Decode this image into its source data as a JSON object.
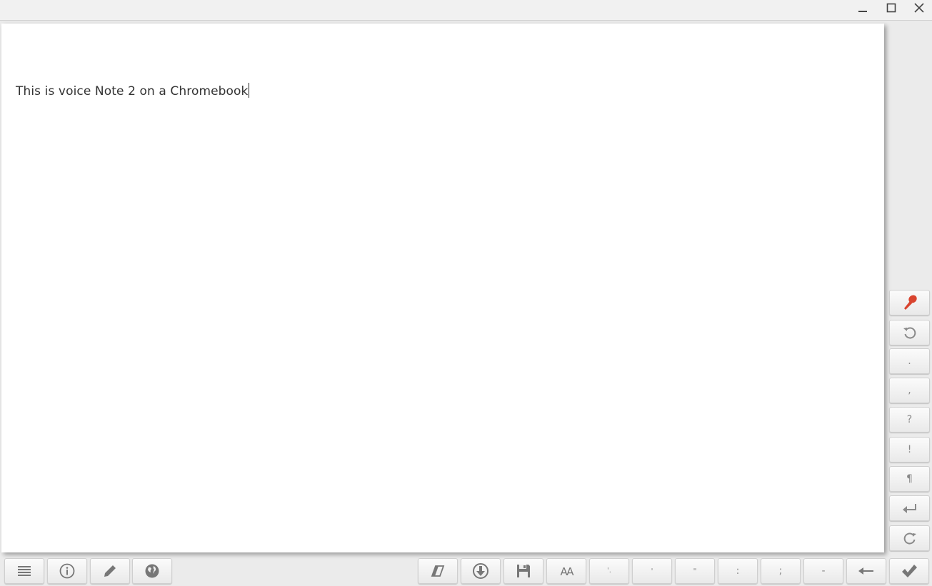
{
  "window": {
    "controls": [
      {
        "name": "minimize-icon"
      },
      {
        "name": "maximize-icon"
      },
      {
        "name": "close-icon"
      }
    ]
  },
  "editor": {
    "text": "This is voice Note 2 on a Chromebook"
  },
  "side_toolbar": {
    "buttons": [
      {
        "name": "microphone-icon",
        "color": "#d9442f"
      },
      {
        "name": "undo-icon"
      },
      {
        "label": "."
      },
      {
        "label": ","
      },
      {
        "label": "?"
      },
      {
        "label": "!"
      },
      {
        "label": "¶"
      },
      {
        "name": "enter-icon"
      },
      {
        "name": "redo-icon"
      }
    ]
  },
  "bottom_toolbar": {
    "left_buttons": [
      {
        "name": "menu-icon"
      },
      {
        "name": "info-icon"
      },
      {
        "name": "pencil-icon"
      },
      {
        "name": "globe-icon"
      }
    ],
    "right_buttons": [
      {
        "name": "eraser-icon"
      },
      {
        "name": "download-icon"
      },
      {
        "name": "save-icon"
      },
      {
        "name": "font-size-icon",
        "label": "AA"
      },
      {
        "label": "'."
      },
      {
        "label": "'"
      },
      {
        "label": "\""
      },
      {
        "label": ":"
      },
      {
        "label": ";"
      },
      {
        "label": "-"
      },
      {
        "name": "backspace-arrow-icon"
      },
      {
        "name": "checkmark-icon"
      }
    ]
  }
}
